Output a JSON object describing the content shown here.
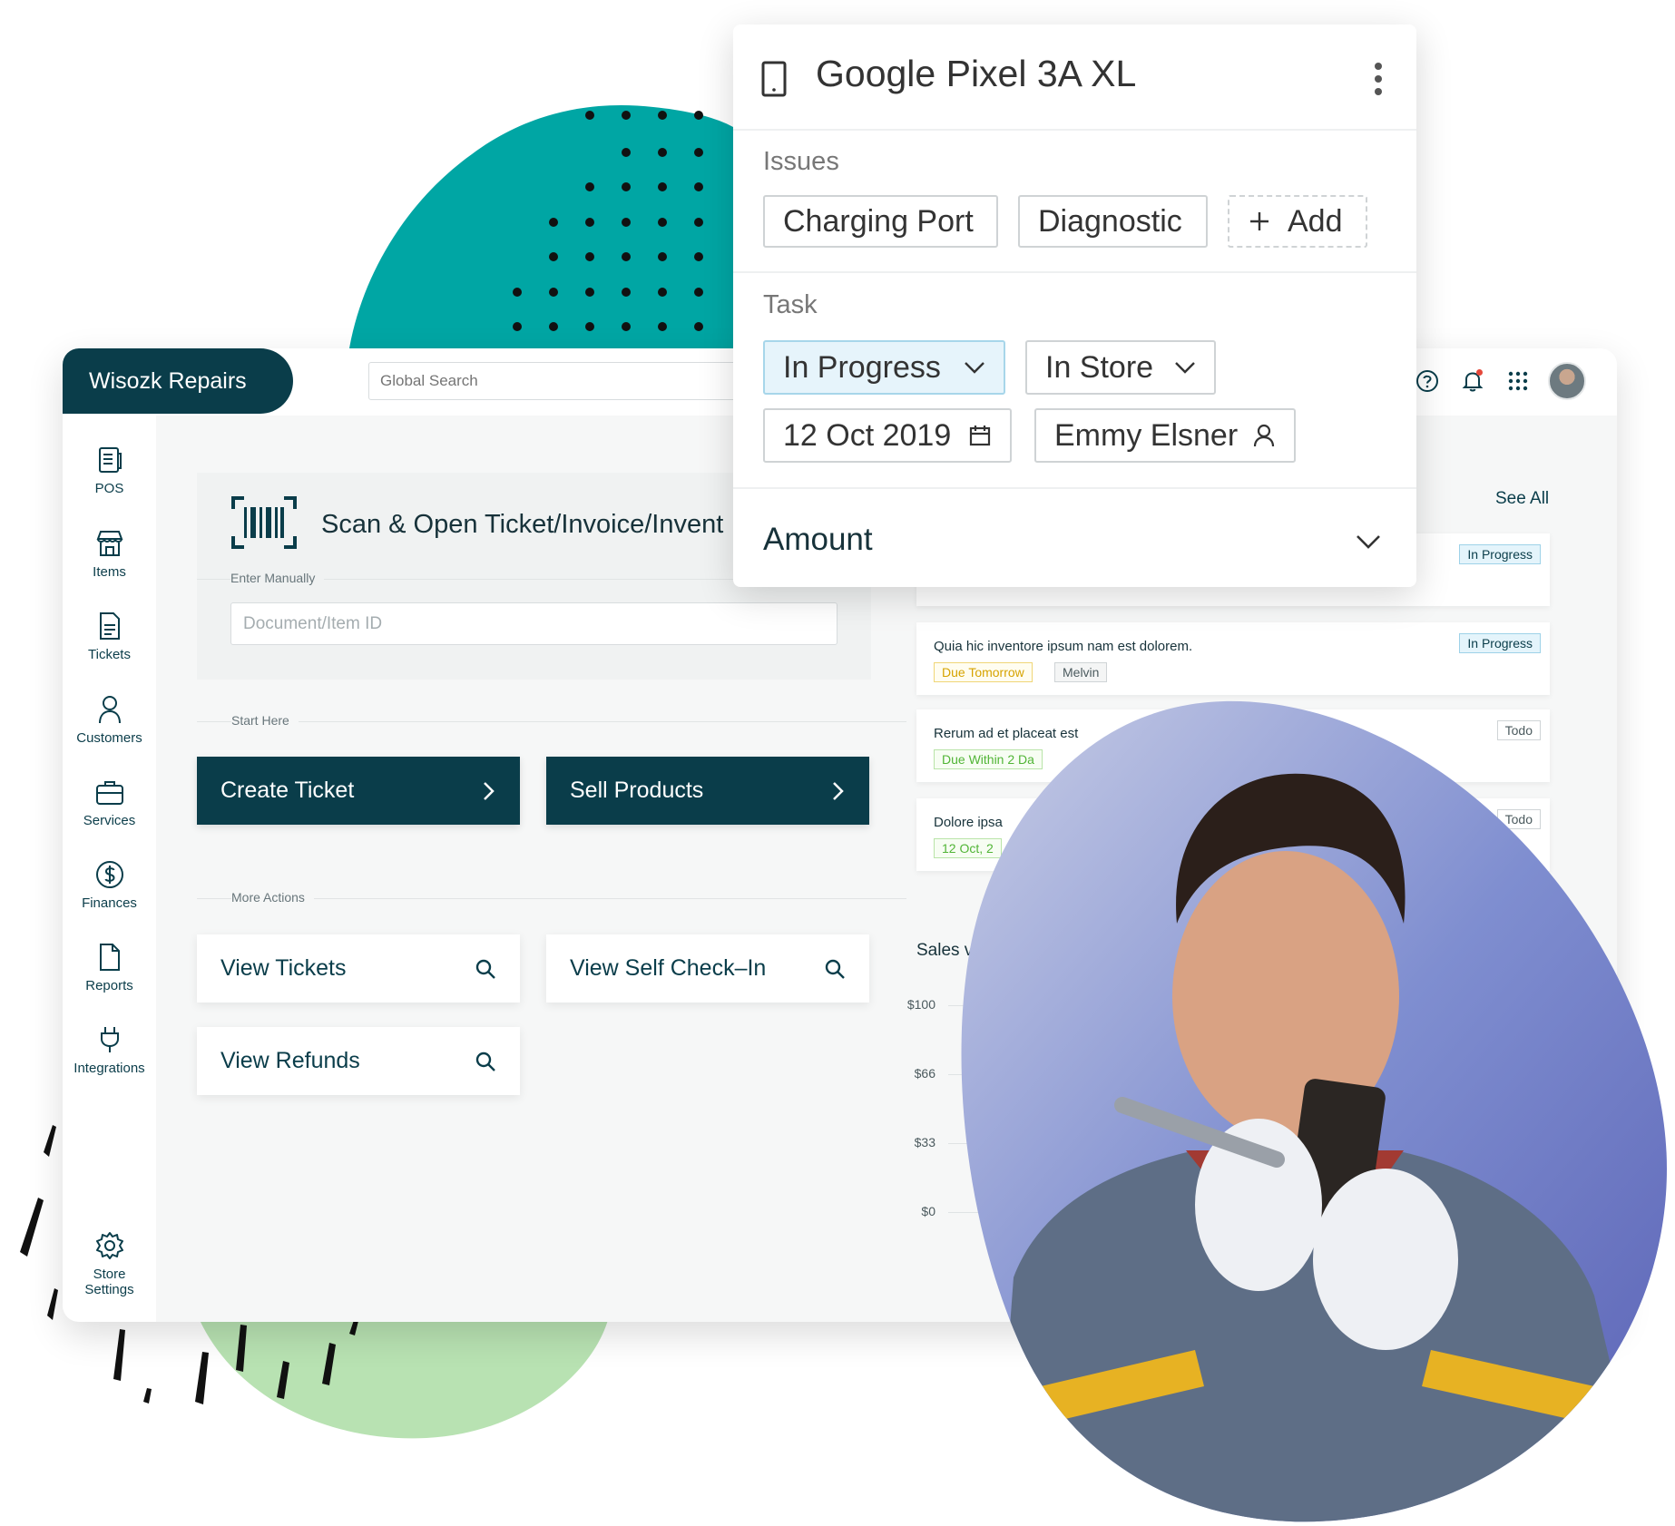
{
  "app": {
    "brand": "Wisozk Repairs",
    "search_placeholder": "Global Search"
  },
  "sidebar": {
    "items": [
      {
        "label": "POS",
        "icon": "pos-icon"
      },
      {
        "label": "Items",
        "icon": "store-icon"
      },
      {
        "label": "Tickets",
        "icon": "ticket-icon"
      },
      {
        "label": "Customers",
        "icon": "person-icon"
      },
      {
        "label": "Services",
        "icon": "briefcase-icon"
      },
      {
        "label": "Finances",
        "icon": "dollar-icon"
      },
      {
        "label": "Reports",
        "icon": "file-icon"
      },
      {
        "label": "Integrations",
        "icon": "plug-icon"
      }
    ],
    "settings": {
      "line1": "Store",
      "line2": "Settings",
      "icon": "gear-icon"
    }
  },
  "scan": {
    "title": "Scan & Open Ticket/Invoice/Invent",
    "manual_label": "Enter Manually",
    "input_placeholder": "Document/Item ID",
    "icon": "barcode-icon"
  },
  "start": {
    "label": "Start Here",
    "create_ticket": "Create Ticket",
    "sell_products": "Sell Products"
  },
  "more": {
    "label": "More Actions",
    "view_tickets": "View Tickets",
    "view_self_checkin": "View Self Check–In",
    "view_refunds": "View Refunds"
  },
  "tasks": {
    "see_all": "See All",
    "items": [
      {
        "title": "Quia hic inventore ipsum nam est dolorem.",
        "status": "In Progress",
        "due": "Due Tomorrow",
        "assignee": "Melvin"
      },
      {
        "title": "Rerum ad et placeat est",
        "status": "Todo",
        "due": "Due Within 2 Da"
      },
      {
        "title": "Dolore ipsa",
        "status": "Todo",
        "due": "12 Oct, 2"
      }
    ],
    "top_status": "In Progress"
  },
  "chart_data": {
    "type": "bar",
    "title": "Sales v",
    "yticks": [
      "$100",
      "$66",
      "$33",
      "$0"
    ]
  },
  "popup": {
    "device": "Google Pixel 3A XL",
    "issues_label": "Issues",
    "issues": [
      "Charging Port",
      "Diagnostic"
    ],
    "add_label": "Add",
    "task_label": "Task",
    "status": "In Progress",
    "location": "In Store",
    "date": "12 Oct 2019",
    "assignee": "Emmy Elsner",
    "amount_label": "Amount"
  },
  "colors": {
    "brand_dark": "#0a3d4a",
    "teal_blob": "#00a6a4",
    "green_blob": "#b8e2b2"
  }
}
